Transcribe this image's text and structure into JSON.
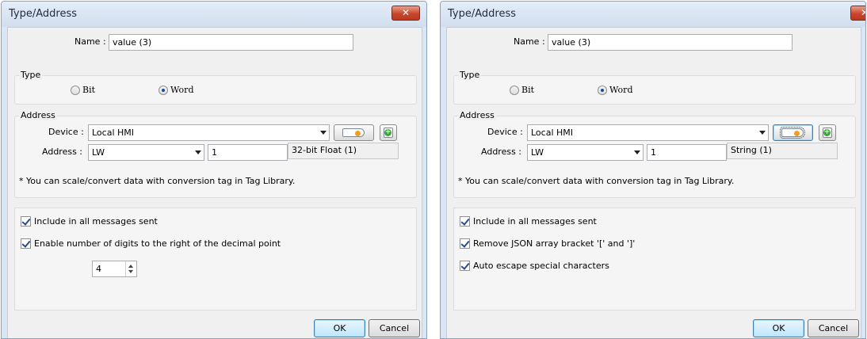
{
  "dialogs": [
    {
      "title": "Type/Address",
      "close_glyph": "✕",
      "name_label": "Name :",
      "name_value": "value (3)",
      "type_group": {
        "title": "Type",
        "options": [
          "Bit",
          "Word"
        ],
        "selected": "Word"
      },
      "address_group": {
        "title": "Address",
        "device_label": "Device :",
        "device_value": "Local HMI",
        "address_label": "Address :",
        "address_type": "LW",
        "address_value": "1",
        "data_format": "32-bit Float (1)",
        "note": "* You can scale/convert data with conversion tag in Tag Library."
      },
      "options": [
        {
          "label": "Include in all messages sent",
          "checked": true
        },
        {
          "label": "Enable number of digits to the right of the decimal point",
          "checked": true
        }
      ],
      "digits_value": "4",
      "ok_label": "OK",
      "cancel_label": "Cancel"
    },
    {
      "title": "Type/Address",
      "close_glyph": "✕",
      "name_label": "Name :",
      "name_value": "value (3)",
      "type_group": {
        "title": "Type",
        "options": [
          "Bit",
          "Word"
        ],
        "selected": "Word"
      },
      "address_group": {
        "title": "Address",
        "device_label": "Device :",
        "device_value": "Local HMI",
        "address_label": "Address :",
        "address_type": "LW",
        "address_value": "1",
        "data_format": "String (1)",
        "note": "* You can scale/convert data with conversion tag in Tag Library."
      },
      "options": [
        {
          "label": "Include in all messages sent",
          "checked": true
        },
        {
          "label": "Remove JSON array bracket '[' and ']'",
          "checked": true
        },
        {
          "label": "Auto escape special characters",
          "checked": true
        }
      ],
      "ok_label": "OK",
      "cancel_label": "Cancel"
    }
  ],
  "colors": {
    "title_bar": "#dbe6f4",
    "close_button": "#c9462b",
    "client_bg": "#f0f0f0",
    "default_button": "#bee6fd"
  },
  "icons": {
    "tag_button": "tag-icon",
    "add_tag_button": "add-tag-icon",
    "close": "close-icon"
  }
}
